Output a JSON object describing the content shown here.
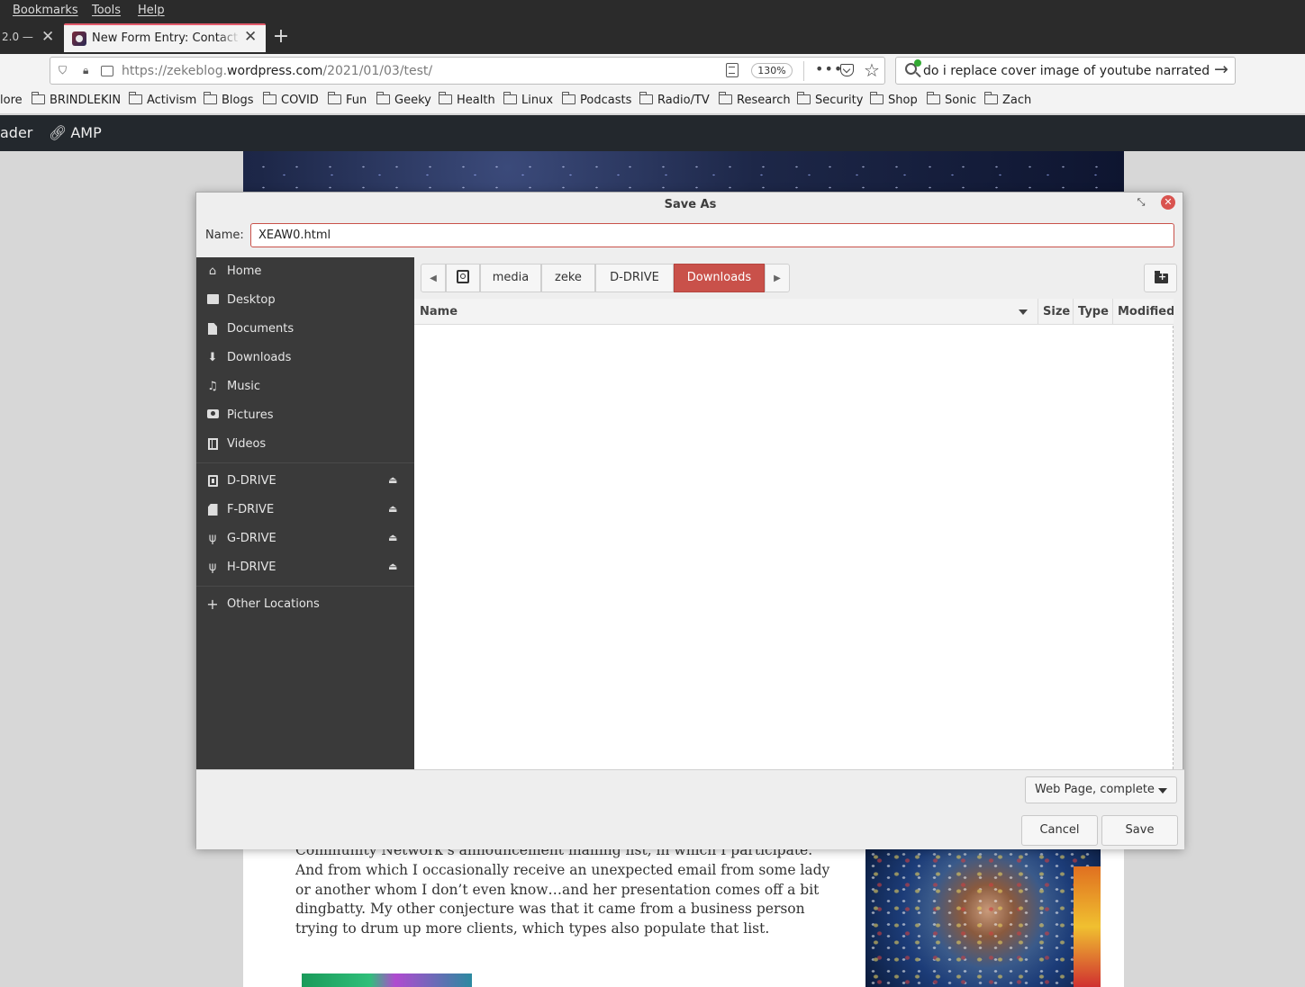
{
  "menubar": {
    "items": [
      "Bookmarks",
      "Tools",
      "Help"
    ]
  },
  "tabs": {
    "prev_label": "2.0 — ",
    "active_title": "New Form Entry: Contact For"
  },
  "navbar": {
    "url_prefix": "https://zekeblog.",
    "url_domain": "wordpress.com",
    "url_path": "/2021/01/03/test/",
    "zoom": "130%",
    "search_value": "do i replace cover image of youtube narrated video"
  },
  "bookmarks": [
    "lore",
    "BRINDLEKIN",
    "Activism",
    "Blogs",
    "COVID",
    "Fun",
    "Geeky",
    "Health",
    "Linux",
    "Podcasts",
    "Radio/TV",
    "Research",
    "Security",
    "Shop",
    "Sonic",
    "Zach"
  ],
  "pagebar": {
    "reader": "ader",
    "amp": "AMP"
  },
  "article": {
    "text": "Community Network’s announcement mailing list, in which I participate. And from which I occasionally receive an unexpected email from some lady or another whom I don’t even know…and her presentation comes off a bit dingbatty. My other conjecture was that it came from a business person trying to drum up more clients, which types also populate that list."
  },
  "dialog": {
    "title": "Save As",
    "name_label": "Name:",
    "name_value": "XEAW0.html",
    "places": [
      {
        "label": "Home",
        "icon": "home-icon"
      },
      {
        "label": "Desktop",
        "icon": "desktop-icon"
      },
      {
        "label": "Documents",
        "icon": "documents-icon"
      },
      {
        "label": "Downloads",
        "icon": "downloads-icon"
      },
      {
        "label": "Music",
        "icon": "music-icon"
      },
      {
        "label": "Pictures",
        "icon": "pictures-icon"
      },
      {
        "label": "Videos",
        "icon": "videos-icon"
      }
    ],
    "devices": [
      {
        "label": "D-DRIVE",
        "icon": "drive-icon"
      },
      {
        "label": "F-DRIVE",
        "icon": "sd-card-icon"
      },
      {
        "label": "G-DRIVE",
        "icon": "usb-icon"
      },
      {
        "label": "H-DRIVE",
        "icon": "usb-icon"
      }
    ],
    "other_locations": "Other Locations",
    "path": [
      "media",
      "zeke",
      "D-DRIVE",
      "Downloads"
    ],
    "columns": {
      "name": "Name",
      "size": "Size",
      "type": "Type",
      "modified": "Modified"
    },
    "file_type": "Web Page, complete",
    "cancel_label": "Cancel",
    "save_label": "Save"
  },
  "colors": {
    "accent": "#c9514a",
    "sidebar_bg": "#3a3a3a",
    "close_button": "#d9534f"
  }
}
